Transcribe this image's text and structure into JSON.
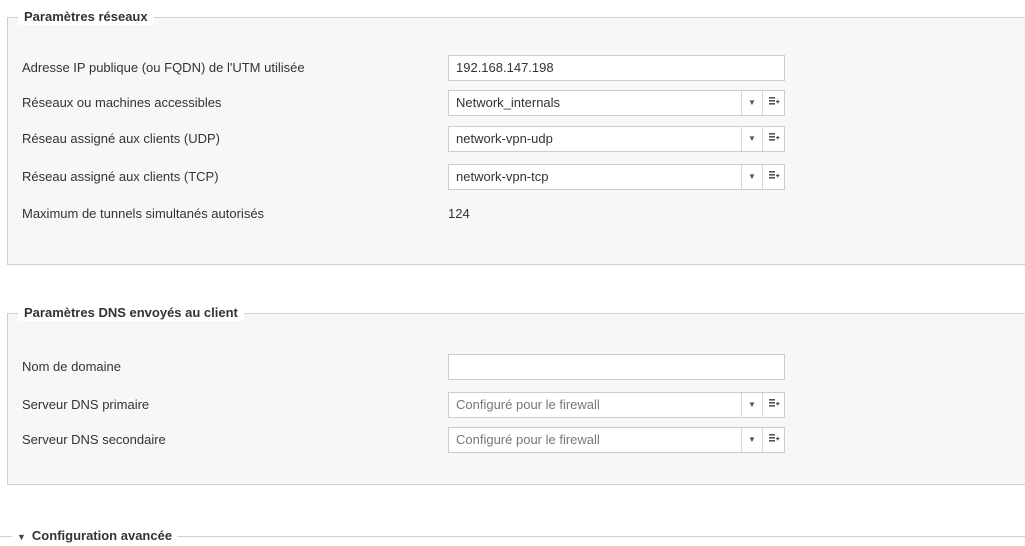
{
  "network": {
    "legend": "Paramètres réseaux",
    "public_ip_label": "Adresse IP publique (ou FQDN) de l'UTM utilisée",
    "public_ip_value": "192.168.147.198",
    "reachable_label": "Réseaux ou machines accessibles",
    "reachable_value": "Network_internals",
    "udp_label": "Réseau assigné aux clients (UDP)",
    "udp_value": "network-vpn-udp",
    "tcp_label": "Réseau assigné aux clients (TCP)",
    "tcp_value": "network-vpn-tcp",
    "max_tunnels_label": "Maximum de tunnels simultanés autorisés",
    "max_tunnels_value": "124"
  },
  "dns": {
    "legend": "Paramètres DNS envoyés au client",
    "domain_label": "Nom de domaine",
    "domain_value": "",
    "primary_label": "Serveur DNS primaire",
    "primary_placeholder": "Configuré pour le firewall",
    "secondary_label": "Serveur DNS secondaire",
    "secondary_placeholder": "Configuré pour le firewall"
  },
  "advanced": {
    "label": "Configuration avancée"
  },
  "icons": {
    "dropdown": "chevron-down-icon",
    "add_object": "add-object-icon",
    "expand": "expand-triangle-icon"
  }
}
